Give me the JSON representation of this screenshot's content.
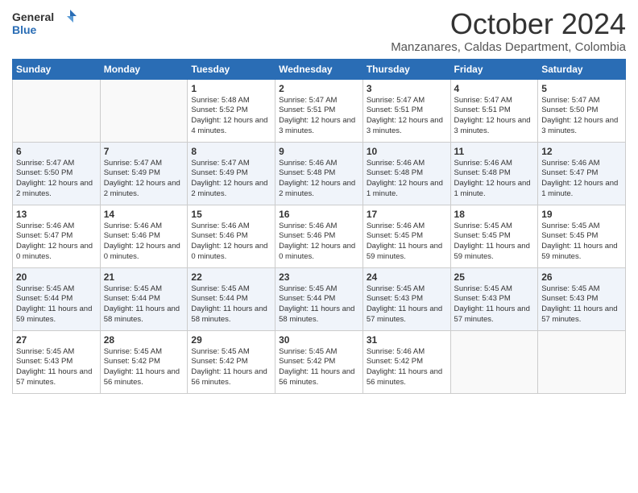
{
  "header": {
    "logo_general": "General",
    "logo_blue": "Blue",
    "month_title": "October 2024",
    "subtitle": "Manzanares, Caldas Department, Colombia"
  },
  "days_of_week": [
    "Sunday",
    "Monday",
    "Tuesday",
    "Wednesday",
    "Thursday",
    "Friday",
    "Saturday"
  ],
  "weeks": [
    [
      {
        "day": "",
        "info": ""
      },
      {
        "day": "",
        "info": ""
      },
      {
        "day": "1",
        "info": "Sunrise: 5:48 AM\nSunset: 5:52 PM\nDaylight: 12 hours and 4 minutes."
      },
      {
        "day": "2",
        "info": "Sunrise: 5:47 AM\nSunset: 5:51 PM\nDaylight: 12 hours and 3 minutes."
      },
      {
        "day": "3",
        "info": "Sunrise: 5:47 AM\nSunset: 5:51 PM\nDaylight: 12 hours and 3 minutes."
      },
      {
        "day": "4",
        "info": "Sunrise: 5:47 AM\nSunset: 5:51 PM\nDaylight: 12 hours and 3 minutes."
      },
      {
        "day": "5",
        "info": "Sunrise: 5:47 AM\nSunset: 5:50 PM\nDaylight: 12 hours and 3 minutes."
      }
    ],
    [
      {
        "day": "6",
        "info": "Sunrise: 5:47 AM\nSunset: 5:50 PM\nDaylight: 12 hours and 2 minutes."
      },
      {
        "day": "7",
        "info": "Sunrise: 5:47 AM\nSunset: 5:49 PM\nDaylight: 12 hours and 2 minutes."
      },
      {
        "day": "8",
        "info": "Sunrise: 5:47 AM\nSunset: 5:49 PM\nDaylight: 12 hours and 2 minutes."
      },
      {
        "day": "9",
        "info": "Sunrise: 5:46 AM\nSunset: 5:48 PM\nDaylight: 12 hours and 2 minutes."
      },
      {
        "day": "10",
        "info": "Sunrise: 5:46 AM\nSunset: 5:48 PM\nDaylight: 12 hours and 1 minute."
      },
      {
        "day": "11",
        "info": "Sunrise: 5:46 AM\nSunset: 5:48 PM\nDaylight: 12 hours and 1 minute."
      },
      {
        "day": "12",
        "info": "Sunrise: 5:46 AM\nSunset: 5:47 PM\nDaylight: 12 hours and 1 minute."
      }
    ],
    [
      {
        "day": "13",
        "info": "Sunrise: 5:46 AM\nSunset: 5:47 PM\nDaylight: 12 hours and 0 minutes."
      },
      {
        "day": "14",
        "info": "Sunrise: 5:46 AM\nSunset: 5:46 PM\nDaylight: 12 hours and 0 minutes."
      },
      {
        "day": "15",
        "info": "Sunrise: 5:46 AM\nSunset: 5:46 PM\nDaylight: 12 hours and 0 minutes."
      },
      {
        "day": "16",
        "info": "Sunrise: 5:46 AM\nSunset: 5:46 PM\nDaylight: 12 hours and 0 minutes."
      },
      {
        "day": "17",
        "info": "Sunrise: 5:46 AM\nSunset: 5:45 PM\nDaylight: 11 hours and 59 minutes."
      },
      {
        "day": "18",
        "info": "Sunrise: 5:45 AM\nSunset: 5:45 PM\nDaylight: 11 hours and 59 minutes."
      },
      {
        "day": "19",
        "info": "Sunrise: 5:45 AM\nSunset: 5:45 PM\nDaylight: 11 hours and 59 minutes."
      }
    ],
    [
      {
        "day": "20",
        "info": "Sunrise: 5:45 AM\nSunset: 5:44 PM\nDaylight: 11 hours and 59 minutes."
      },
      {
        "day": "21",
        "info": "Sunrise: 5:45 AM\nSunset: 5:44 PM\nDaylight: 11 hours and 58 minutes."
      },
      {
        "day": "22",
        "info": "Sunrise: 5:45 AM\nSunset: 5:44 PM\nDaylight: 11 hours and 58 minutes."
      },
      {
        "day": "23",
        "info": "Sunrise: 5:45 AM\nSunset: 5:44 PM\nDaylight: 11 hours and 58 minutes."
      },
      {
        "day": "24",
        "info": "Sunrise: 5:45 AM\nSunset: 5:43 PM\nDaylight: 11 hours and 57 minutes."
      },
      {
        "day": "25",
        "info": "Sunrise: 5:45 AM\nSunset: 5:43 PM\nDaylight: 11 hours and 57 minutes."
      },
      {
        "day": "26",
        "info": "Sunrise: 5:45 AM\nSunset: 5:43 PM\nDaylight: 11 hours and 57 minutes."
      }
    ],
    [
      {
        "day": "27",
        "info": "Sunrise: 5:45 AM\nSunset: 5:43 PM\nDaylight: 11 hours and 57 minutes."
      },
      {
        "day": "28",
        "info": "Sunrise: 5:45 AM\nSunset: 5:42 PM\nDaylight: 11 hours and 56 minutes."
      },
      {
        "day": "29",
        "info": "Sunrise: 5:45 AM\nSunset: 5:42 PM\nDaylight: 11 hours and 56 minutes."
      },
      {
        "day": "30",
        "info": "Sunrise: 5:45 AM\nSunset: 5:42 PM\nDaylight: 11 hours and 56 minutes."
      },
      {
        "day": "31",
        "info": "Sunrise: 5:46 AM\nSunset: 5:42 PM\nDaylight: 11 hours and 56 minutes."
      },
      {
        "day": "",
        "info": ""
      },
      {
        "day": "",
        "info": ""
      }
    ]
  ]
}
